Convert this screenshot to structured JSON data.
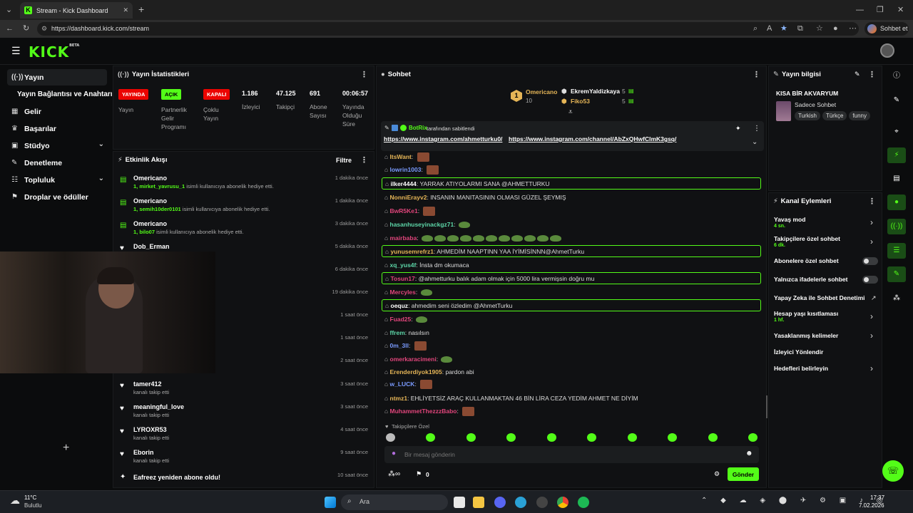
{
  "browser": {
    "tab_title": "Stream - Kick Dashboard",
    "url": "https://dashboard.kick.com/stream",
    "profile_label": "Sohbet et"
  },
  "header": {
    "logo": "KICK",
    "logo_sup": "BETA"
  },
  "sidebar": {
    "items": [
      {
        "label": "Yayın",
        "icon": "broadcast-icon"
      },
      {
        "label": "Yayın Bağlantısı ve Anahtarı",
        "icon": ""
      },
      {
        "label": "Gelir",
        "icon": "revenue-icon"
      },
      {
        "label": "Başarılar",
        "icon": "trophy-icon"
      },
      {
        "label": "Stüdyo",
        "icon": "studio-icon"
      },
      {
        "label": "Denetleme",
        "icon": "wrench-icon"
      },
      {
        "label": "Topluluk",
        "icon": "community-icon"
      },
      {
        "label": "Droplar ve ödüller",
        "icon": "gift-icon"
      }
    ],
    "plus": "+"
  },
  "stats": {
    "title": "Yayın İstatistikleri",
    "badges": [
      {
        "label": "YAYINDA",
        "caption": "Yayın"
      },
      {
        "label": "AÇIK",
        "caption": "Partnerlik Gelir Programı"
      },
      {
        "label": "KAPALI",
        "caption": "Çoklu Yayın"
      }
    ],
    "values": [
      {
        "value": "1.186",
        "label": "İzleyici"
      },
      {
        "value": "47.125",
        "label": "Takipçi"
      },
      {
        "value": "691",
        "label": "Abone Sayısı"
      },
      {
        "value": "00:06:57",
        "label": "Yayında Olduğu Süre"
      }
    ]
  },
  "activity": {
    "title": "Etkinlik Akışı",
    "filter": "Filtre",
    "items": [
      {
        "name": "Omericano",
        "prefix": "1, ",
        "target": "mirket_yavrusu_1",
        "text": " isimli kullanıcıya abonelik hediye etti.",
        "time": "1 dakika önce",
        "type": "gift"
      },
      {
        "name": "Omericano",
        "prefix": "1, ",
        "target": "semih10der0101",
        "text": " isimli kullanıcıya abonelik hediye etti.",
        "time": "1 dakika önce",
        "type": "gift"
      },
      {
        "name": "Omericano",
        "prefix": "1, ",
        "target": "bilo07",
        "text": " isimli kullanıcıya abonelik hediye etti.",
        "time": "3 dakika önce",
        "type": "gift"
      },
      {
        "name": "Dob_Erman",
        "prefix": "",
        "target": "",
        "text": "",
        "time": "5 dakika önce",
        "type": "follow"
      },
      {
        "name": "",
        "prefix": "",
        "target": "",
        "text": "",
        "time": "6 dakika önce",
        "type": "follow"
      },
      {
        "name": "",
        "prefix": "",
        "target": "",
        "text": "",
        "time": "19 dakika önce",
        "type": "follow"
      },
      {
        "name": "",
        "prefix": "",
        "target": "",
        "text": "",
        "time": "1 saat önce",
        "type": "follow"
      },
      {
        "name": "",
        "prefix": "",
        "target": "",
        "text": "",
        "time": "1 saat önce",
        "type": "follow"
      },
      {
        "name": "",
        "prefix": "",
        "target": "",
        "text": "",
        "time": "2 saat önce",
        "type": "follow"
      },
      {
        "name": "tamer412",
        "prefix": "",
        "target": "",
        "text": "kanalı takip etti",
        "time": "3 saat önce",
        "type": "follow"
      },
      {
        "name": "meaningful_love",
        "prefix": "",
        "target": "",
        "text": "kanalı takip etti",
        "time": "3 saat önce",
        "type": "follow"
      },
      {
        "name": "LYROXR53",
        "prefix": "",
        "target": "",
        "text": "kanalı takip etti",
        "time": "4 saat önce",
        "type": "follow"
      },
      {
        "name": "Eborin",
        "prefix": "",
        "target": "",
        "text": "kanalı takip etti",
        "time": "9 saat önce",
        "type": "follow"
      },
      {
        "name": "Eafreez yeniden abone oldu!",
        "prefix": "",
        "target": "",
        "text": "",
        "time": "10 saat önce",
        "type": "resub"
      }
    ]
  },
  "chat": {
    "title": "Sohbet",
    "leaderboard": [
      {
        "name": "Omericano",
        "count": "10",
        "rank": "1"
      },
      {
        "name": "EkremYaldizkaya",
        "count": "5"
      },
      {
        "name": "Fiko53",
        "count": "5"
      }
    ],
    "pinned": {
      "by": "BotRix",
      "by_text": "tarafından sabitlendi",
      "link1": "https://www.instagram.com/ahmetturku0/",
      "link2": "https://www.instagram.com/channel/AbZxQHwfClmK3gsq/"
    },
    "messages": [
      {
        "name": "ItsWant",
        "color": "#e5b557",
        "text": "",
        "emote": true,
        "hl": false
      },
      {
        "name": "lowrin1003",
        "color": "#7a9bff",
        "text": "",
        "emote": true,
        "hl": false
      },
      {
        "name": "ilker4444",
        "color": "#ffffff",
        "text": "YARRAK ATIYOLARMI SANA @AHMETTURKU",
        "emote": false,
        "hl": true
      },
      {
        "name": "NonniErayv2",
        "color": "#e5b557",
        "text": "INSANIN MANITASININ OLMASI GÜZEL ŞEYMIŞ",
        "emote": false,
        "hl": false
      },
      {
        "name": "BwR5Ke1",
        "color": "#e0457b",
        "text": "",
        "emote": true,
        "hl": false
      },
      {
        "name": "hasanhuseyinackgz71",
        "color": "#5dd6a8",
        "text": "",
        "frogs": 1,
        "hl": false
      },
      {
        "name": "mairbaba",
        "color": "#e0457b",
        "text": "",
        "frogs": 11,
        "hl": false
      },
      {
        "name": "yunusemrefrz1",
        "color": "#e5b557",
        "text": "AHMEDİM NAAPTINN YAA İYİMİSİNNN@AhmetTurku",
        "emote": false,
        "hl": true
      },
      {
        "name": "xq_yus4f",
        "color": "#5dd6a8",
        "text": "İnsta dm okumaca",
        "emote": false,
        "hl": false
      },
      {
        "name": "Tosun17",
        "color": "#e0457b",
        "text": "@ahmetturku balık adam olmak için 5000 lira vermişsin doğru mu",
        "emote": false,
        "hl": true
      },
      {
        "name": "Mercyles",
        "color": "#e0457b",
        "text": "",
        "frogs": 1,
        "hl": false
      },
      {
        "name": "oequz",
        "color": "#ffffff",
        "text": "ahmedim seni özledim @AhmetTurku",
        "emote": false,
        "hl": true
      },
      {
        "name": "Fuad25",
        "color": "#e0457b",
        "text": "",
        "frogs": 1,
        "hl": false
      },
      {
        "name": "ffrem",
        "color": "#5dd6a8",
        "text": "nasılsın",
        "emote": false,
        "hl": false
      },
      {
        "name": "0m_3ll",
        "color": "#7a9bff",
        "text": "",
        "emote": true,
        "hl": false
      },
      {
        "name": "omerkaracimeni",
        "color": "#e0457b",
        "text": "",
        "frogs": 1,
        "hl": false
      },
      {
        "name": "Erenderdiyok1905",
        "color": "#e5b557",
        "text": "pardon abi",
        "emote": false,
        "hl": false
      },
      {
        "name": "w_LUCK",
        "color": "#7a9bff",
        "text": "",
        "emote": true,
        "hl": false
      },
      {
        "name": "ntmz1",
        "color": "#e5b557",
        "text": "EHLİYETSİZ ARAÇ KULLANMAKTAN 46 BİN LİRA CEZA YEDİM AHMET NE DİYİM",
        "emote": false,
        "hl": false
      },
      {
        "name": "MuhammetThezzzBabo",
        "color": "#e0457b",
        "text": "",
        "emote": true,
        "hl": false
      }
    ],
    "followers_only": "Takipçilere Özel",
    "input_placeholder": "Bir mesaj gönderin",
    "send_label": "Gönder",
    "bottom_count": "0"
  },
  "stream_info": {
    "title": "Yayın bilgisi",
    "stream_title": "KISA BİR AKVARYUM",
    "category": "Sadece Sohbet",
    "tags": [
      "Turkish",
      "Türkçe",
      "funny"
    ]
  },
  "channel_actions": {
    "title": "Kanal Eylemleri",
    "items": [
      {
        "label": "Yavaş mod",
        "sub": "4 sn.",
        "control": "chevron"
      },
      {
        "label": "Takipçilere özel sohbet",
        "sub": "6 dk.",
        "control": "chevron"
      },
      {
        "label": "Abonelere özel sohbet",
        "sub": "",
        "control": "toggle"
      },
      {
        "label": "Yalnızca ifadelerle sohbet",
        "sub": "",
        "control": "toggle"
      },
      {
        "label": "Yapay Zeka ile Sohbet Denetimi",
        "sub": "",
        "control": "ext"
      },
      {
        "label": "Hesap yaşı kısıtlaması",
        "sub": "1 hf.",
        "control": "chevron"
      },
      {
        "label": "Yasaklanmış kelimeler",
        "sub": "",
        "control": "chevron"
      },
      {
        "label": "İzleyici Yönlendir",
        "sub": "",
        "control": "none"
      },
      {
        "label": "Hedefleri belirleyin",
        "sub": "",
        "control": "chevron"
      }
    ]
  },
  "taskbar": {
    "weather_temp": "11°C",
    "weather_desc": "Bulutlu",
    "search": "Ara",
    "time": "17:37",
    "date": "7.02.2026"
  },
  "colors": {
    "accent": "#53fc18",
    "live": "#eb0400"
  }
}
